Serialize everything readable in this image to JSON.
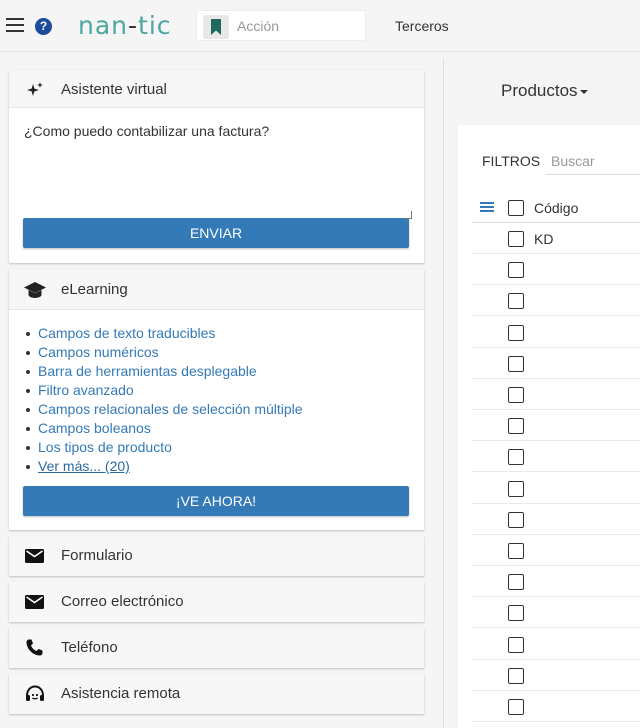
{
  "header": {
    "logo": "nan-tic",
    "logo_left": "nan",
    "logo_dash": "-",
    "logo_right": "tic",
    "action_placeholder": "Acción",
    "terceros_label": "Terceros",
    "icons": [
      "menu-icon",
      "help-icon",
      "bookmark-icon"
    ]
  },
  "assistant": {
    "title": "Asistente virtual",
    "question": "¿Como puedo contabilizar una factura?",
    "send_label": "ENVIAR",
    "icon": "sparkle-icon"
  },
  "elearning": {
    "title": "eLearning",
    "icon": "graduation-cap-icon",
    "links": [
      "Campos de texto traducibles",
      "Campos numéricos",
      "Barra de herramientas desplegable",
      "Filtro avanzado",
      "Campos relacionales de selección múltiple",
      "Campos boleanos",
      "Los tipos de producto"
    ],
    "more_label": "Ver más... (20)",
    "cta_label": "¡VE AHORA!"
  },
  "contact": [
    {
      "title": "Formulario",
      "icon": "envelope-icon"
    },
    {
      "title": "Correo electrónico",
      "icon": "envelope-icon"
    },
    {
      "title": "Teléfono",
      "icon": "phone-icon"
    },
    {
      "title": "Asistencia remota",
      "icon": "headset-icon"
    }
  ],
  "products": {
    "title": "Productos",
    "filters_label": "FILTROS",
    "search_placeholder": "Buscar",
    "column_code": "Código",
    "rows": [
      "KD",
      "",
      "",
      "",
      "",
      "",
      "",
      "",
      "",
      "",
      "",
      "",
      "",
      "",
      "",
      ""
    ]
  },
  "colors": {
    "accent": "#337ab7",
    "logo": "#4aa7a1",
    "help": "#1a4d9b"
  }
}
